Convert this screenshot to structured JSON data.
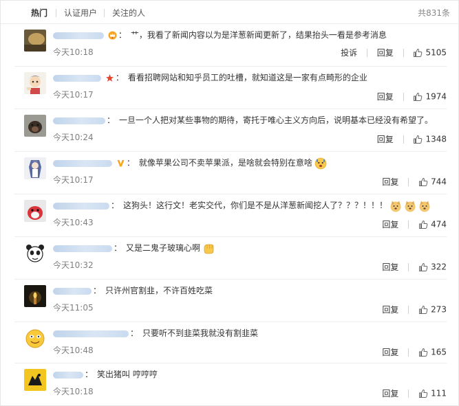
{
  "tabs": [
    {
      "label": "热门",
      "active": true
    },
    {
      "label": "认证用户",
      "active": false
    },
    {
      "label": "关注的人",
      "active": false
    }
  ],
  "total_count": "共831条",
  "colors": {
    "accent": "#eb7350",
    "name_blur": "#c7daf0",
    "muted": "#808080"
  },
  "comments": [
    {
      "avatar": "photo-avatar",
      "badge": "crown-badge",
      "text": "艹，我看了新闻内容以为是洋葱新闻更新了，结果抬头一看是参考消息",
      "time": "今天10:18",
      "report": "投诉",
      "reply": "回复",
      "likes": "5105"
    },
    {
      "avatar": "cartoon-avatar",
      "badge": "star-badge",
      "text": "看看招聘网站和知乎员工的吐槽，就知道这是一家有点畸形的企业",
      "time": "今天10:17",
      "reply": "回复",
      "likes": "1974"
    },
    {
      "avatar": "dog-avatar",
      "text": "一旦一个人把对某些事物的期待，寄托于唯心主义方向后，说明基本已经没有希望了。",
      "time": "今天10:24",
      "reply": "回复",
      "likes": "1348"
    },
    {
      "avatar": "anime-avatar",
      "badge": "v-badge",
      "text": "就像苹果公司不卖苹果派，是啥就会特别在意啥",
      "emoji_count": 1,
      "time": "今天10:17",
      "reply": "回复",
      "likes": "744"
    },
    {
      "avatar": "bird-avatar",
      "text": "这狗头！这行文！老实交代，你们是不是从洋葱新闻挖人了？？？！！！",
      "emoji_count": 3,
      "time": "今天10:43",
      "reply": "回复",
      "likes": "474"
    },
    {
      "avatar": "panda-avatar",
      "text": "又是二鬼子玻璃心啊",
      "emoji_count": 1,
      "time": "今天10:32",
      "reply": "回复",
      "likes": "322"
    },
    {
      "avatar": "candle-avatar",
      "text": "只许州官割韭，不许百姓吃菜",
      "time": "今天11:05",
      "reply": "回复",
      "likes": "273"
    },
    {
      "avatar": "smiley-avatar",
      "text": "只要听不到韭菜我就没有割韭菜",
      "time": "今天10:48",
      "reply": "回复",
      "likes": "165"
    },
    {
      "avatar": "emblem-avatar",
      "text": "笑出猪叫 哼哼哼",
      "time": "今天10:18",
      "reply": "回复",
      "likes": "111"
    }
  ]
}
